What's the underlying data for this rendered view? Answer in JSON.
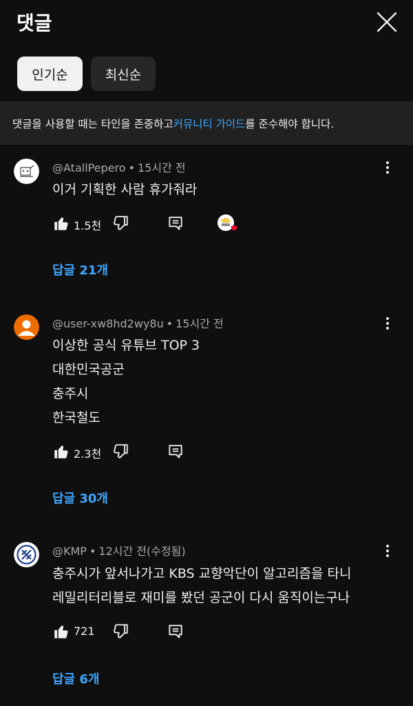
{
  "header": {
    "title": "댓글"
  },
  "sort_chips": [
    {
      "label": "인기순",
      "selected": true
    },
    {
      "label": "최신순",
      "selected": false
    }
  ],
  "notice": {
    "before": "댓글을 사용할 때는 타인을 존중하고 ",
    "link": "커뮤니티 가이드",
    "after": "를 준수해야 합니다."
  },
  "colors": {
    "accent_link": "#3ea6ff",
    "background": "#0f0f0f",
    "surface": "#212121",
    "heart": "#ff0033"
  },
  "comments": [
    {
      "author": "@AtallPepero",
      "time": "15시간 전",
      "lines": [
        "이거 기획한 사람 휴가줘라"
      ],
      "likes": "1.5천",
      "creator_hearted": true,
      "replies": "답글 21개"
    },
    {
      "author": "@user-xw8hd2wy8u",
      "time": "15시간 전",
      "lines": [
        "이상한 공식 유튜브 TOP 3",
        "대한민국공군",
        "충주시",
        "한국철도"
      ],
      "likes": "2.3천",
      "creator_hearted": false,
      "replies": "답글 30개"
    },
    {
      "author": "@KMP",
      "time": "12시간 전(수정됨)",
      "lines": [
        "충주시가 앞서나가고 KBS 교향악단이 알고리즘을 타니",
        "레밀리터리블로 재미를 봤던 공군이 다시 움직이는구나"
      ],
      "likes": "721",
      "creator_hearted": false,
      "replies": "답글 6개"
    }
  ],
  "icons": {
    "close": "close-icon",
    "more": "more-vert-icon",
    "like": "thumb-up-icon",
    "dislike": "thumb-down-icon",
    "reply": "comment-icon"
  }
}
